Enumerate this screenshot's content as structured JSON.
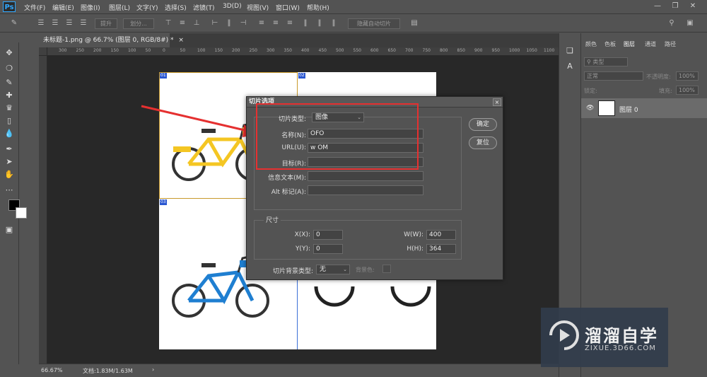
{
  "app": {
    "logo": "Ps"
  },
  "menubar": {
    "items": [
      "文件(F)",
      "编辑(E)",
      "图像(I)",
      "图层(L)",
      "文字(Y)",
      "选择(S)",
      "滤镜(T)",
      "3D(D)",
      "视图(V)",
      "窗口(W)",
      "帮助(H)"
    ]
  },
  "optionsbar": {
    "promote_label": "提升",
    "divide_label": "划分...",
    "hide_auto_slices_label": "隐藏自动切片"
  },
  "document": {
    "tab_title": "未标题-1.png @ 66.7% (图层 0, RGB/8#) *",
    "tab_close": "×"
  },
  "ruler": {
    "ticks": [
      "300",
      "250",
      "200",
      "150",
      "100",
      "50",
      "0",
      "50",
      "100",
      "150",
      "200",
      "250",
      "300",
      "350",
      "400",
      "450",
      "500",
      "550",
      "600",
      "650",
      "700",
      "750",
      "800",
      "850",
      "900",
      "950",
      "1000",
      "1050",
      "1100"
    ]
  },
  "slices": {
    "tags": [
      "01",
      "02",
      "03"
    ]
  },
  "statusbar": {
    "zoom": "66.67%",
    "doc_info": "文档:1.83M/1.63M",
    "arrow": "›"
  },
  "panel": {
    "tabs": [
      "颜色",
      "色板",
      "图层",
      "通道",
      "路径"
    ],
    "kind_filter": "类型",
    "blend_mode": "正常",
    "opacity_label": "不透明度:",
    "opacity_value": "100%",
    "lock_label": "锁定:",
    "fill_label": "填充:",
    "fill_value": "100%",
    "layer_name": "图层 0"
  },
  "dialog": {
    "title": "切片选项",
    "close": "×",
    "slice_type_label": "切片类型:",
    "slice_type_value": "图像",
    "name_label": "名称(N):",
    "name_value": "OFO",
    "url_label": "URL(U):",
    "url_value": "w            OM",
    "target_label": "目标(R):",
    "target_value": "",
    "message_label": "信息文本(M):",
    "message_value": "",
    "alt_label": "Alt 标记(A):",
    "alt_value": "",
    "ok_label": "确定",
    "reset_label": "复位",
    "dimensions_label": "尺寸",
    "x_label": "X(X):",
    "x_value": "0",
    "y_label": "Y(Y):",
    "y_value": "0",
    "w_label": "W(W):",
    "w_value": "400",
    "h_label": "H(H):",
    "h_value": "364",
    "bg_type_label": "切片背景类型:",
    "bg_type_value": "无",
    "bg_color_label": "背景色:"
  },
  "watermark": {
    "title": "溜溜自学",
    "url": "ZIXUE.3D66.COM"
  },
  "colors": {
    "highlight": "#e53030",
    "slice_line": "#3b6fd6",
    "ps_blue": "#31a8ff"
  }
}
